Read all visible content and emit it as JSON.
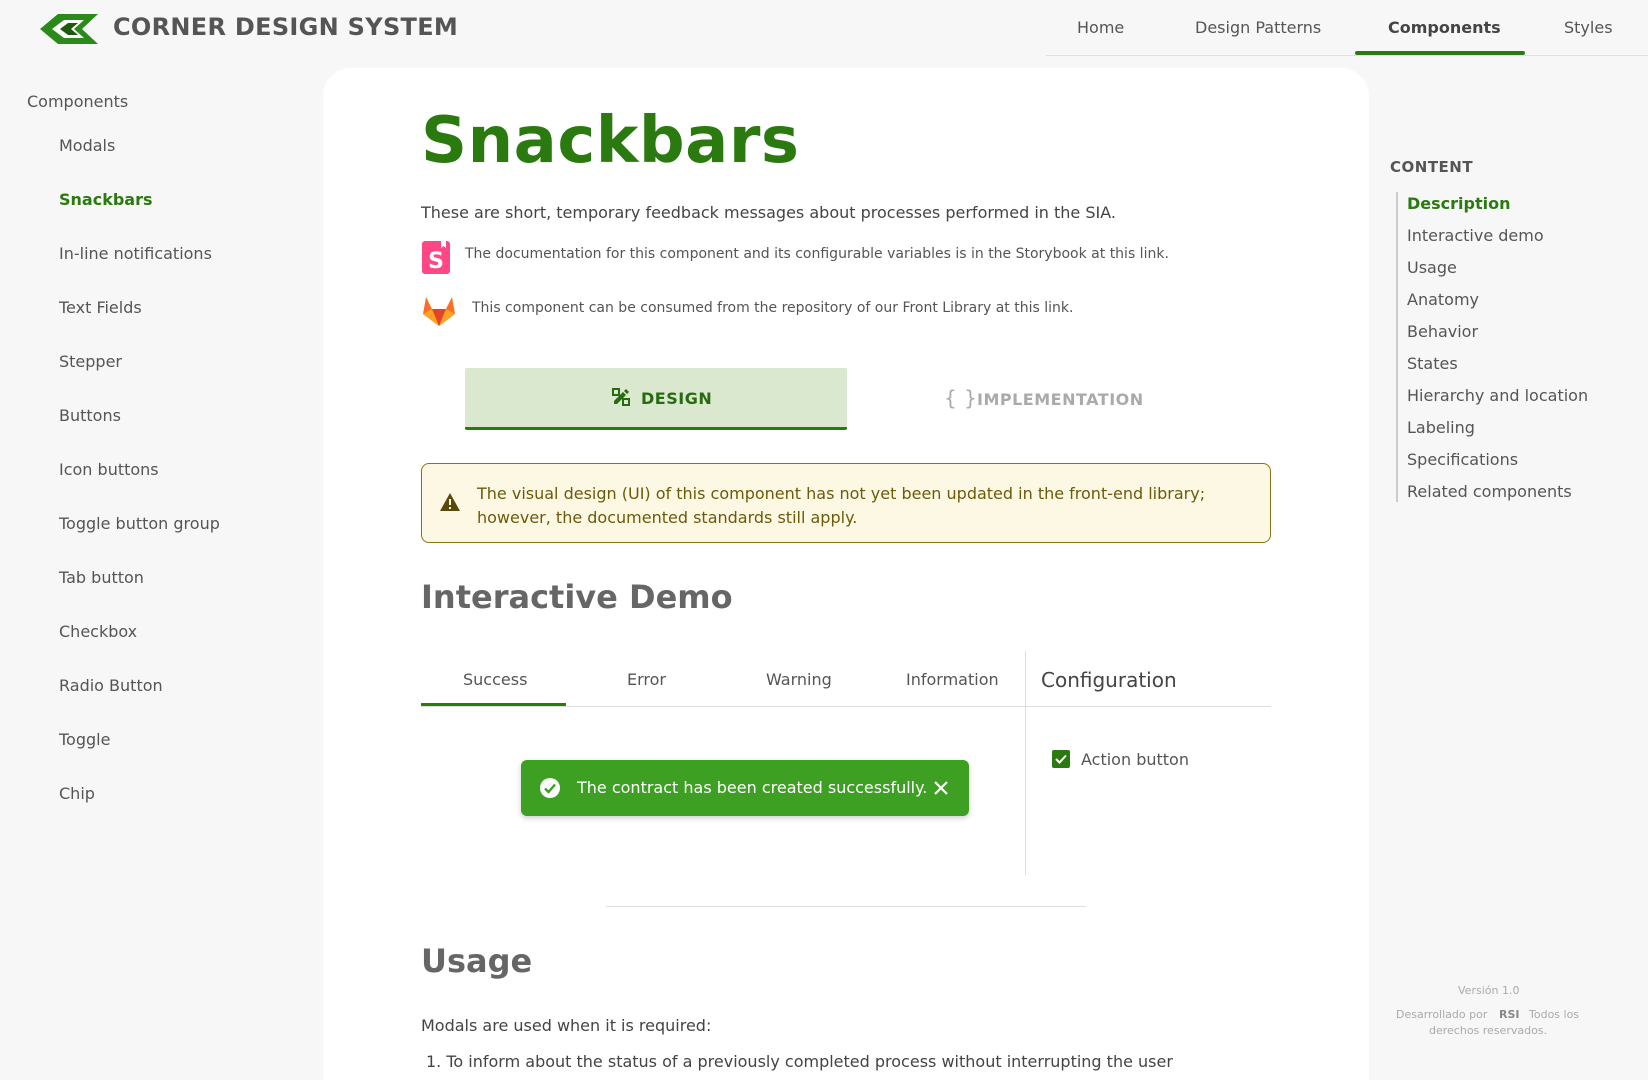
{
  "header": {
    "brand": "CORNER DESIGN SYSTEM",
    "nav": [
      {
        "label": "Home"
      },
      {
        "label": "Design Patterns"
      },
      {
        "label": "Components",
        "active": true
      },
      {
        "label": "Styles"
      }
    ]
  },
  "sidebar": {
    "root": "Components",
    "items": [
      {
        "label": "Modals"
      },
      {
        "label": "Snackbars",
        "active": true
      },
      {
        "label": "In-line notifications"
      },
      {
        "label": "Text Fields"
      },
      {
        "label": "Stepper"
      },
      {
        "label": "Buttons"
      },
      {
        "label": "Icon buttons"
      },
      {
        "label": "Toggle button group"
      },
      {
        "label": "Tab button"
      },
      {
        "label": "Checkbox"
      },
      {
        "label": "Radio Button"
      },
      {
        "label": "Toggle"
      },
      {
        "label": "Chip"
      }
    ]
  },
  "main": {
    "title": "Snackbars",
    "lead": "These are short, temporary feedback messages about processes performed in the SIA.",
    "storybook_text": "The documentation for this component and its configurable variables is in the Storybook at this link.",
    "gitlab_text": "This component can be consumed from the repository of our Front Library at this link.",
    "tabs": {
      "design": "DESIGN",
      "implementation": "IMPLEMENTATION"
    },
    "alert": "The visual design (UI) of this component has not yet been updated in the front-end library; however, the documented standards still apply.",
    "demo_heading": "Interactive Demo",
    "demo_tabs": [
      {
        "label": "Success",
        "active": true
      },
      {
        "label": "Error"
      },
      {
        "label": "Warning"
      },
      {
        "label": "Information"
      }
    ],
    "config_title": "Configuration",
    "snackbar_message": "The contract has been created successfully.",
    "action_button_label": "Action button",
    "action_button_checked": true,
    "usage_heading": "Usage",
    "usage_para": "Modals are used when it is required:",
    "usage_item_1": "1. To inform about the status of a previously completed process without interrupting the user"
  },
  "toc": {
    "title": "CONTENT",
    "items": [
      {
        "label": "Description",
        "active": true
      },
      {
        "label": "Interactive demo"
      },
      {
        "label": "Usage"
      },
      {
        "label": "Anatomy"
      },
      {
        "label": "Behavior"
      },
      {
        "label": "States"
      },
      {
        "label": "Hierarchy and location"
      },
      {
        "label": "Labeling"
      },
      {
        "label": "Specifications"
      },
      {
        "label": "Related components"
      }
    ]
  },
  "footer": {
    "version": "Versión 1.0",
    "developed_by": "Desarrollado por",
    "company": "RSI",
    "rights_1": "Todos los",
    "rights_2": "derechos reservados."
  },
  "colors": {
    "accent": "#2a7a0f",
    "snackbar_success": "#3da022",
    "tab_active_bg": "#d9e8cf",
    "alert_bg": "#fdf8e4",
    "alert_border": "#8a7314"
  },
  "icons": {
    "logo": "corner-logo",
    "storybook": "storybook-icon",
    "gitlab": "gitlab-icon",
    "design_tab": "pencil-ruler-icon",
    "implementation_tab": "code-braces-icon",
    "alert": "warning-triangle-icon",
    "snackbar_status": "check-circle-icon",
    "snackbar_close": "close-icon",
    "checkbox": "checkbox-checked-icon"
  }
}
